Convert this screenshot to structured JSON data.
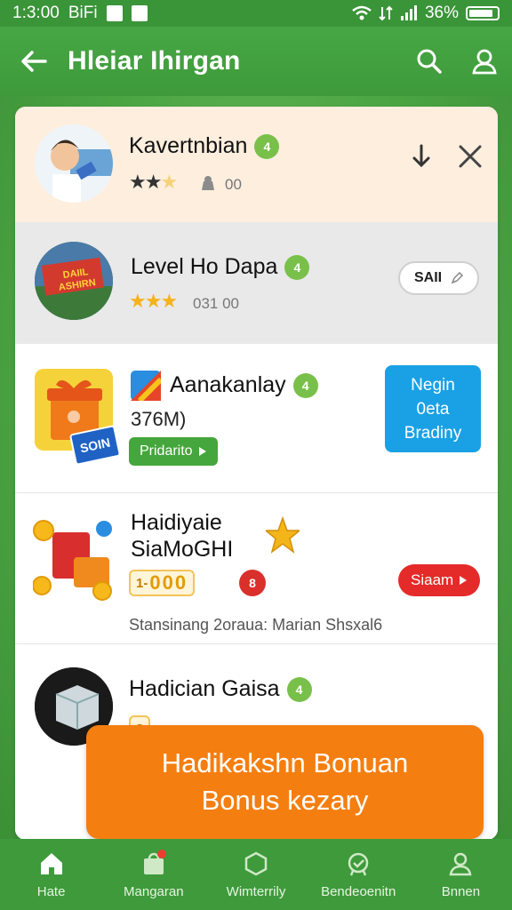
{
  "status_bar": {
    "time": "1:3:00",
    "carrier": "BiFi",
    "battery": "36%"
  },
  "app_bar": {
    "title": "Hleiar Ihirgan"
  },
  "list": {
    "items": [
      {
        "name": "Kavertnbian",
        "rating": 2,
        "meta": "00"
      },
      {
        "name": "Level Ho Dapa",
        "rating": 3,
        "meta": "031 00",
        "action": "SAII"
      },
      {
        "name": "Aanakanlay",
        "sub": "376M)",
        "tag": "Pridarito",
        "action_lines": [
          "Negin",
          "0eta",
          "Bradiny"
        ],
        "thumb_text": "SOIN"
      },
      {
        "name_line1": "Haidiyaie",
        "name_line2": "SiaMoGHI",
        "coins": [
          "000",
          "0"
        ],
        "coin_prefix": "1-",
        "coin_badge": "8",
        "action": "Siaam",
        "footer": "Stansinang 2oraua: Marian Shsxal6"
      },
      {
        "name": "Hadician Gaisa",
        "coin_prefix": "8"
      }
    ],
    "badge_symbol": "4",
    "thumb_banner_line1": "DAIIL",
    "thumb_banner_line2": "ASHIRN"
  },
  "promo": {
    "line1": "Hadikakshn Bonuan",
    "line2": "Bonus kezary"
  },
  "bottom_nav": {
    "items": [
      {
        "label": "Hate",
        "icon": "home-icon"
      },
      {
        "label": "Mangaran",
        "icon": "store-icon"
      },
      {
        "label": "Wimterrily",
        "icon": "hexagon-icon"
      },
      {
        "label": "Bendeoenitn",
        "icon": "badge-check-icon"
      },
      {
        "label": "Bnnen",
        "icon": "profile-icon"
      }
    ]
  },
  "colors": {
    "primary_green": "#3e9a3b",
    "promo_orange": "#f57e10",
    "blue_button": "#1aa1e5",
    "red_button": "#e52a2a",
    "badge_green": "#79c04a"
  }
}
